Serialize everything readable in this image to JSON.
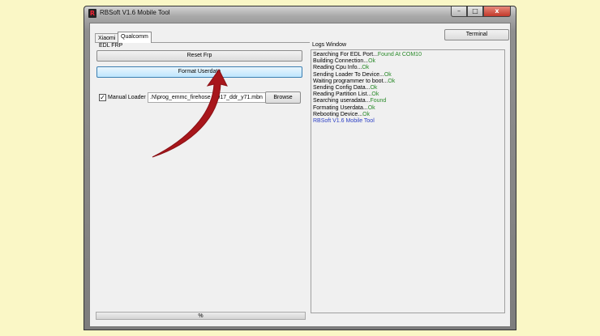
{
  "window": {
    "title": "RBSoft V1.6 Mobile Tool",
    "icon_letter": "R",
    "minimize": "–",
    "maximize": "□",
    "close": "x"
  },
  "tabs": [
    {
      "label": "Xiaomi",
      "active": false
    },
    {
      "label": "Qualcomm",
      "active": true
    }
  ],
  "terminal_button": "Terminal",
  "edl_section": {
    "label": "EDL FRP",
    "reset_frp": "Reset Frp",
    "format_userdata": "Format Userdata"
  },
  "loader": {
    "checkbox_checked": true,
    "check_glyph": "✓",
    "label": "Manual Loader",
    "path_value": ".N\\prog_emmc_firehose_8917_ddr_y71.mbn",
    "browse": "Browse"
  },
  "logs": {
    "title": "Logs Window",
    "lines": [
      {
        "text": "Searching For EDL Port...",
        "status": "Found At COM10"
      },
      {
        "text": "Building Connection...",
        "status": "Ok"
      },
      {
        "text": "Reading Cpu Info...",
        "status": "Ok"
      },
      {
        "text": "Sending Loader To Device...",
        "status": "Ok"
      },
      {
        "text": "Waiting programmer to boot...",
        "status": "Ok"
      },
      {
        "text": "Sending Config Data...",
        "status": "Ok"
      },
      {
        "text": "Reading Partition List...",
        "status": "Ok"
      },
      {
        "text": "Searching useradata...",
        "status": "Found"
      },
      {
        "text": "Formating Userdata...",
        "status": "Ok"
      },
      {
        "text": "Rebooting Device...",
        "status": "Ok"
      }
    ],
    "footer_line": "RBSoft V1.6 Mobile Tool"
  },
  "progress": {
    "label": "%",
    "value_percent": 0
  },
  "colors": {
    "background": "#faf7c6",
    "ok_status": "#2a8a2a",
    "footer_blue": "#2c3fc4",
    "arrow": "#a8161b"
  }
}
